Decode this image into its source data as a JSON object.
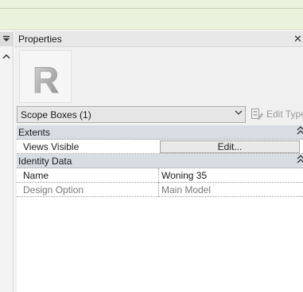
{
  "colors": {
    "ribbon_bg": "#eaf2dd",
    "panel_bg": "#f0f0f0",
    "group_bg": "#d8dde3",
    "readonly_text": "#7a7a7a"
  },
  "left_strip": {
    "menu_icon": "dropdown-menu-icon",
    "collapse_icon": "chevron-up-icon"
  },
  "panel": {
    "title": "Properties",
    "close_icon": "close-icon",
    "type_image_letter": "R",
    "type_selector": {
      "value": "Scope Boxes (1)"
    },
    "edit_type_label": "Edit Type"
  },
  "groups": [
    {
      "label": "Extents",
      "rows": [
        {
          "name": "Views Visible",
          "button_label": "Edit..."
        }
      ]
    },
    {
      "label": "Identity Data",
      "rows": [
        {
          "name": "Name",
          "value": "Woning 35"
        },
        {
          "name": "Design Option",
          "value": "Main Model"
        }
      ]
    }
  ]
}
